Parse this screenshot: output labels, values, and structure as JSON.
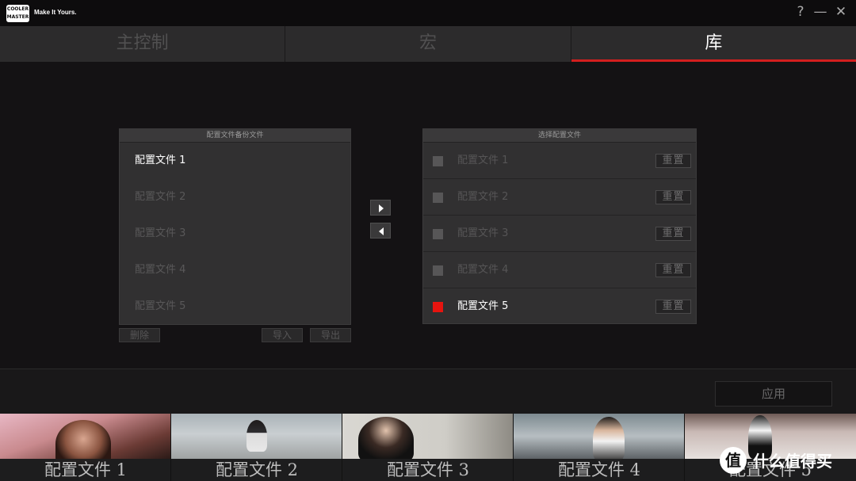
{
  "titlebar": {
    "logo_text": "COOLER MASTER",
    "tagline": "Make It Yours.",
    "help": "?",
    "minimize": "—",
    "close": "✕"
  },
  "tabs": [
    {
      "label": "主控制",
      "active": false
    },
    {
      "label": "宏",
      "active": false
    },
    {
      "label": "库",
      "active": true
    }
  ],
  "backup_panel": {
    "title": "配置文件备份文件",
    "items": [
      "配置文件 1",
      "配置文件 2",
      "配置文件 3",
      "配置文件 4",
      "配置文件 5"
    ],
    "selected_index": 0,
    "buttons": {
      "delete": "删除",
      "import": "导入",
      "export": "导出"
    }
  },
  "select_panel": {
    "title": "选择配置文件",
    "items": [
      {
        "label": "配置文件 1",
        "reset": "重置",
        "active": false
      },
      {
        "label": "配置文件 2",
        "reset": "重置",
        "active": false
      },
      {
        "label": "配置文件 3",
        "reset": "重置",
        "active": false
      },
      {
        "label": "配置文件 4",
        "reset": "重置",
        "active": false
      },
      {
        "label": "配置文件 5",
        "reset": "重置",
        "active": true
      }
    ]
  },
  "apply_label": "应用",
  "profiles_strip": [
    "配置文件 1",
    "配置文件 2",
    "配置文件 3",
    "配置文件 4",
    "配置文件 5"
  ],
  "watermark": {
    "badge": "值",
    "text": "什么值得买"
  },
  "colors": {
    "accent": "#d31e1e",
    "active_checkbox": "#e6140f"
  }
}
